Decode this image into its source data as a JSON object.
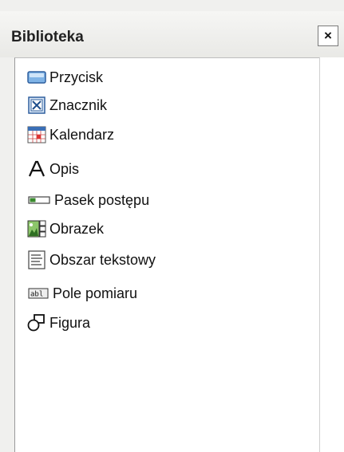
{
  "panel": {
    "title": "Biblioteka",
    "close_label": "×"
  },
  "items": [
    {
      "label": "Przycisk",
      "icon": "button-icon"
    },
    {
      "label": "Znacznik",
      "icon": "checkbox-icon"
    },
    {
      "label": "Kalendarz",
      "icon": "calendar-icon"
    },
    {
      "label": "Opis",
      "icon": "label-text-icon"
    },
    {
      "label": "Pasek postępu",
      "icon": "progress-bar-icon"
    },
    {
      "label": "Obrazek",
      "icon": "image-icon"
    },
    {
      "label": "Obszar tekstowy",
      "icon": "text-area-icon"
    },
    {
      "label": "Pole pomiaru",
      "icon": "measure-field-icon"
    },
    {
      "label": "Figura",
      "icon": "shape-icon"
    }
  ],
  "colors": {
    "panel_bg": "#f0f0ee",
    "list_bg": "#ffffff",
    "icon_blue": "#3b6fb6",
    "icon_green": "#3a8a2e",
    "icon_red": "#c0392b"
  }
}
